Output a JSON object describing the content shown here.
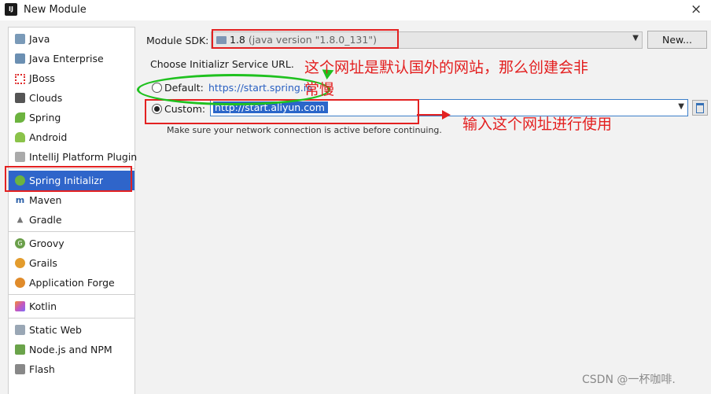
{
  "window": {
    "title": "New Module",
    "icon_text": "IJ",
    "close_glyph": "×"
  },
  "sidebar": {
    "groups": [
      [
        {
          "label": "Java",
          "icon": "java-icon"
        },
        {
          "label": "Java Enterprise",
          "icon": "java-enterprise-icon"
        },
        {
          "label": "JBoss",
          "icon": "jboss-icon"
        },
        {
          "label": "Clouds",
          "icon": "clouds-icon"
        },
        {
          "label": "Spring",
          "icon": "spring-leaf-icon"
        },
        {
          "label": "Android",
          "icon": "android-icon"
        },
        {
          "label": "IntelliJ Platform Plugin",
          "icon": "plugin-icon"
        }
      ],
      [
        {
          "label": "Spring Initializr",
          "icon": "spring-initializr-icon",
          "selected": true
        },
        {
          "label": "Maven",
          "icon": "maven-icon"
        },
        {
          "label": "Gradle",
          "icon": "gradle-icon"
        }
      ],
      [
        {
          "label": "Groovy",
          "icon": "groovy-icon"
        },
        {
          "label": "Grails",
          "icon": "grails-icon"
        },
        {
          "label": "Application Forge",
          "icon": "application-forge-icon"
        }
      ],
      [
        {
          "label": "Kotlin",
          "icon": "kotlin-icon"
        }
      ],
      [
        {
          "label": "Static Web",
          "icon": "static-web-icon"
        },
        {
          "label": "Node.js and NPM",
          "icon": "nodejs-icon"
        },
        {
          "label": "Flash",
          "icon": "flash-icon"
        }
      ]
    ]
  },
  "form": {
    "module_sdk_label": "Module SDK:",
    "sdk_value": "1.8",
    "sdk_version": "(java version \"1.8.0_131\")",
    "new_button": "New...",
    "choose_label": "Choose Initializr Service URL.",
    "default_label": "Default:",
    "default_url": "https://start.spring.io",
    "custom_label": "Custom:",
    "custom_url": "http://start.aliyun.com",
    "hint": "Make sure your network connection is active before continuing.",
    "selected_option": "custom"
  },
  "annotations": {
    "top_line1": "这个网址是默认国外的网站，那么创建会非",
    "top_line2": "常慢",
    "right": "输入这个网址进行使用"
  },
  "watermark": "CSDN @一杯咖啡.",
  "colors": {
    "selection": "#2f65ca",
    "annotation_red": "#e32121",
    "annotation_green": "#1fc11f",
    "link": "#2a60c2"
  }
}
